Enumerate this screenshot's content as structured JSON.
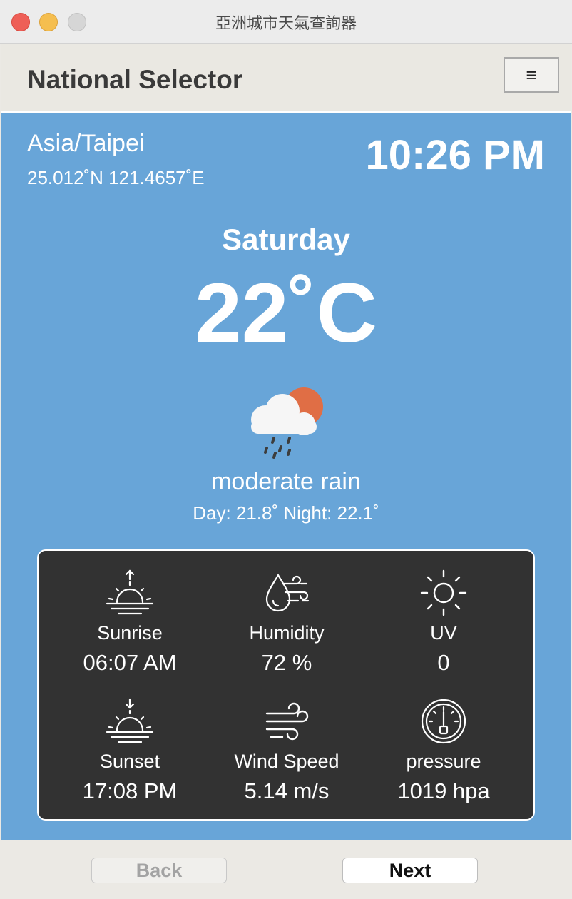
{
  "window": {
    "title": "亞洲城市天氣查詢器"
  },
  "header": {
    "title": "National Selector",
    "menu_label": "≡"
  },
  "location": {
    "timezone": "Asia/Taipei",
    "coordinates": "25.012˚N 121.4657˚E"
  },
  "clock": {
    "time": "10:26 PM"
  },
  "forecast": {
    "day": "Saturday",
    "temperature": "22˚C",
    "icon": "rain-cloud-sun-icon",
    "description": "moderate rain",
    "day_night": "Day: 21.8˚  Night: 22.1˚"
  },
  "stats": {
    "sunrise": {
      "label": "Sunrise",
      "value": "06:07 AM",
      "icon": "sunrise-icon"
    },
    "humidity": {
      "label": "Humidity",
      "value": "72 %",
      "icon": "humidity-icon"
    },
    "uv": {
      "label": "UV",
      "value": "0",
      "icon": "sun-icon"
    },
    "sunset": {
      "label": "Sunset",
      "value": "17:08 PM",
      "icon": "sunset-icon"
    },
    "wind": {
      "label": "Wind Speed",
      "value": "5.14 m/s",
      "icon": "wind-icon"
    },
    "pressure": {
      "label": "pressure",
      "value": "1019 hpa",
      "icon": "gauge-icon"
    }
  },
  "footer": {
    "back_label": "Back",
    "next_label": "Next"
  },
  "colors": {
    "panel_blue": "#68a5d8",
    "card_dark": "#323232",
    "sun_orange": "#e06e45"
  }
}
